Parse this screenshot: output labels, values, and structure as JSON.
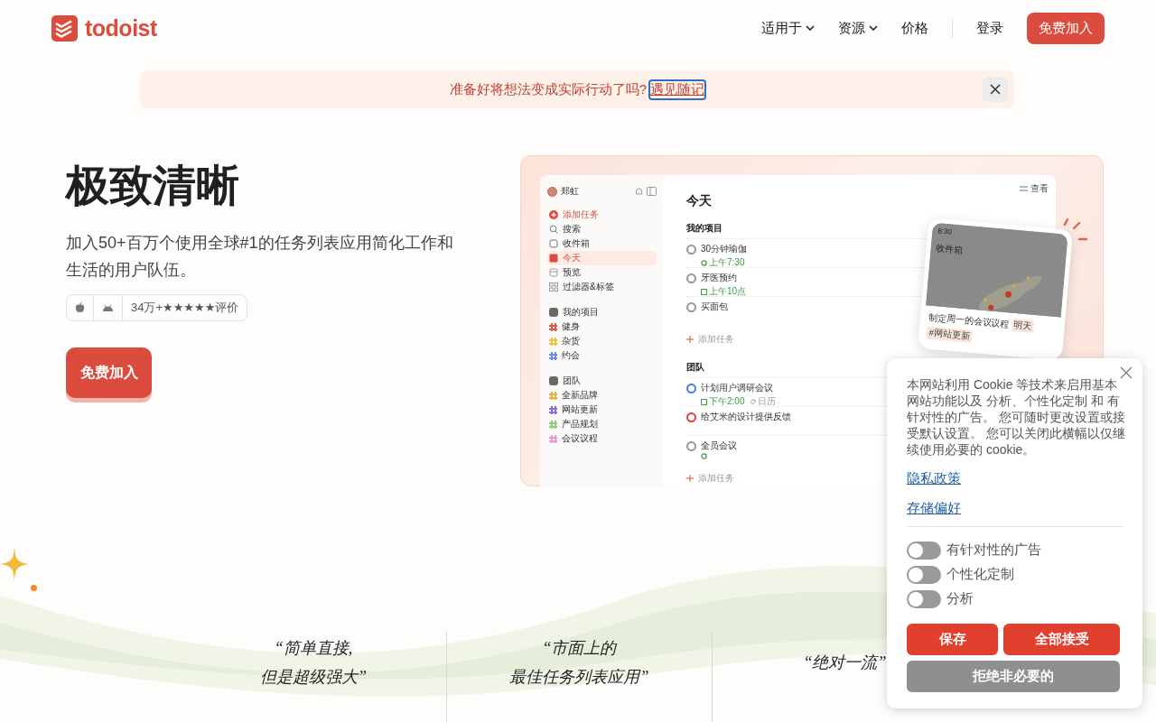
{
  "header": {
    "brand": "todoist",
    "nav": [
      {
        "label": "适用于",
        "kind": "menu"
      },
      {
        "label": "资源",
        "kind": "menu"
      },
      {
        "label": "价格",
        "kind": "link"
      },
      {
        "label": "登录",
        "kind": "link"
      }
    ],
    "cta": "免费加入"
  },
  "banner": {
    "text": "准备好将想法变成实际行动了吗?",
    "link": "遇见随记"
  },
  "hero": {
    "title": "极致清晰",
    "subtitle": "加入50+百万个使用全球#1的任务列表应用简化工作和生活的用户队伍。",
    "rating": "34万+★★★★★评价",
    "cta": "免费加入"
  },
  "app": {
    "user": "郑虹",
    "view": "查看",
    "sidebar": [
      {
        "label": "添加任务",
        "kind": "add",
        "selected": false
      },
      {
        "label": "搜索",
        "kind": "search",
        "selected": false
      },
      {
        "label": "收件箱",
        "kind": "inbox",
        "selected": false
      },
      {
        "label": "今天",
        "kind": "today",
        "selected": true
      },
      {
        "label": "预览",
        "kind": "upcoming",
        "selected": false
      },
      {
        "label": "过滤器&标签",
        "kind": "filters",
        "selected": false
      }
    ],
    "groups": [
      {
        "label": "我的项目",
        "children": [
          {
            "label": "健身",
            "color": "#e05a4a"
          },
          {
            "label": "杂货",
            "color": "#f0c040"
          },
          {
            "label": "约会",
            "color": "#6c8ee8"
          }
        ]
      },
      {
        "label": "团队",
        "children": [
          {
            "label": "全新品牌",
            "color": "#e8b04a"
          },
          {
            "label": "网站更新",
            "color": "#8e6ce0"
          },
          {
            "label": "产品规划",
            "color": "#8ccf7a"
          },
          {
            "label": "会议议程",
            "color": "#e89ad0"
          }
        ]
      }
    ],
    "title": "今天",
    "sections": [
      {
        "label": "我的项目",
        "add": "添加任务",
        "tasks": [
          {
            "name": "30分钟瑜伽",
            "color": "#999999",
            "meta": [
              {
                "kind": "repeat",
                "text": "上午7:30"
              }
            ]
          },
          {
            "name": "牙医预约",
            "color": "#999999",
            "meta": [
              {
                "kind": "date",
                "text": "上午10点"
              }
            ]
          },
          {
            "name": "买面包",
            "color": "#999999"
          }
        ]
      },
      {
        "label": "团队",
        "add": "添加任务",
        "tasks": [
          {
            "name": "计划用户调研会议",
            "color": "#4a7ee8",
            "meta": [
              {
                "kind": "date",
                "text": "下午2:00"
              },
              {
                "kind": "calendar",
                "text": "日历"
              }
            ]
          },
          {
            "name": "给艾米的设计提供反馈",
            "color": "#e0443a"
          },
          {
            "name": "全员会议",
            "color": "#999999",
            "meta": [
              {
                "kind": "repeat"
              }
            ]
          }
        ]
      }
    ],
    "phone": {
      "time": "8:30",
      "title": "收件箱",
      "task": "制定周一的会议议程",
      "tags": [
        "明天",
        "#网站更新"
      ]
    }
  },
  "quotes": [
    [
      "“简单直接,",
      "但是超级强大”"
    ],
    [
      "“市面上的",
      "最佳任务列表应用”"
    ],
    [
      "“绝对一流”"
    ]
  ],
  "cookie": {
    "text": "本网站利用 Cookie 等技术来启用基本网站功能以及 分析、个性化定制 和 有针对性的广告。 您可随时更改设置或接受默认设置。 您可以关闭此横幅以仅继续使用必要的 cookie。",
    "links": [
      "隐私政策",
      "存储偏好"
    ],
    "toggles": [
      {
        "label": "有针对性的广告",
        "on": false
      },
      {
        "label": "个性化定制",
        "on": false
      },
      {
        "label": "分析",
        "on": false
      }
    ],
    "buttons": [
      {
        "label": "保存",
        "kind": "primary"
      },
      {
        "label": "全部接受",
        "kind": "primary"
      },
      {
        "label": "拒绝非必要的",
        "kind": "secondary"
      }
    ]
  }
}
